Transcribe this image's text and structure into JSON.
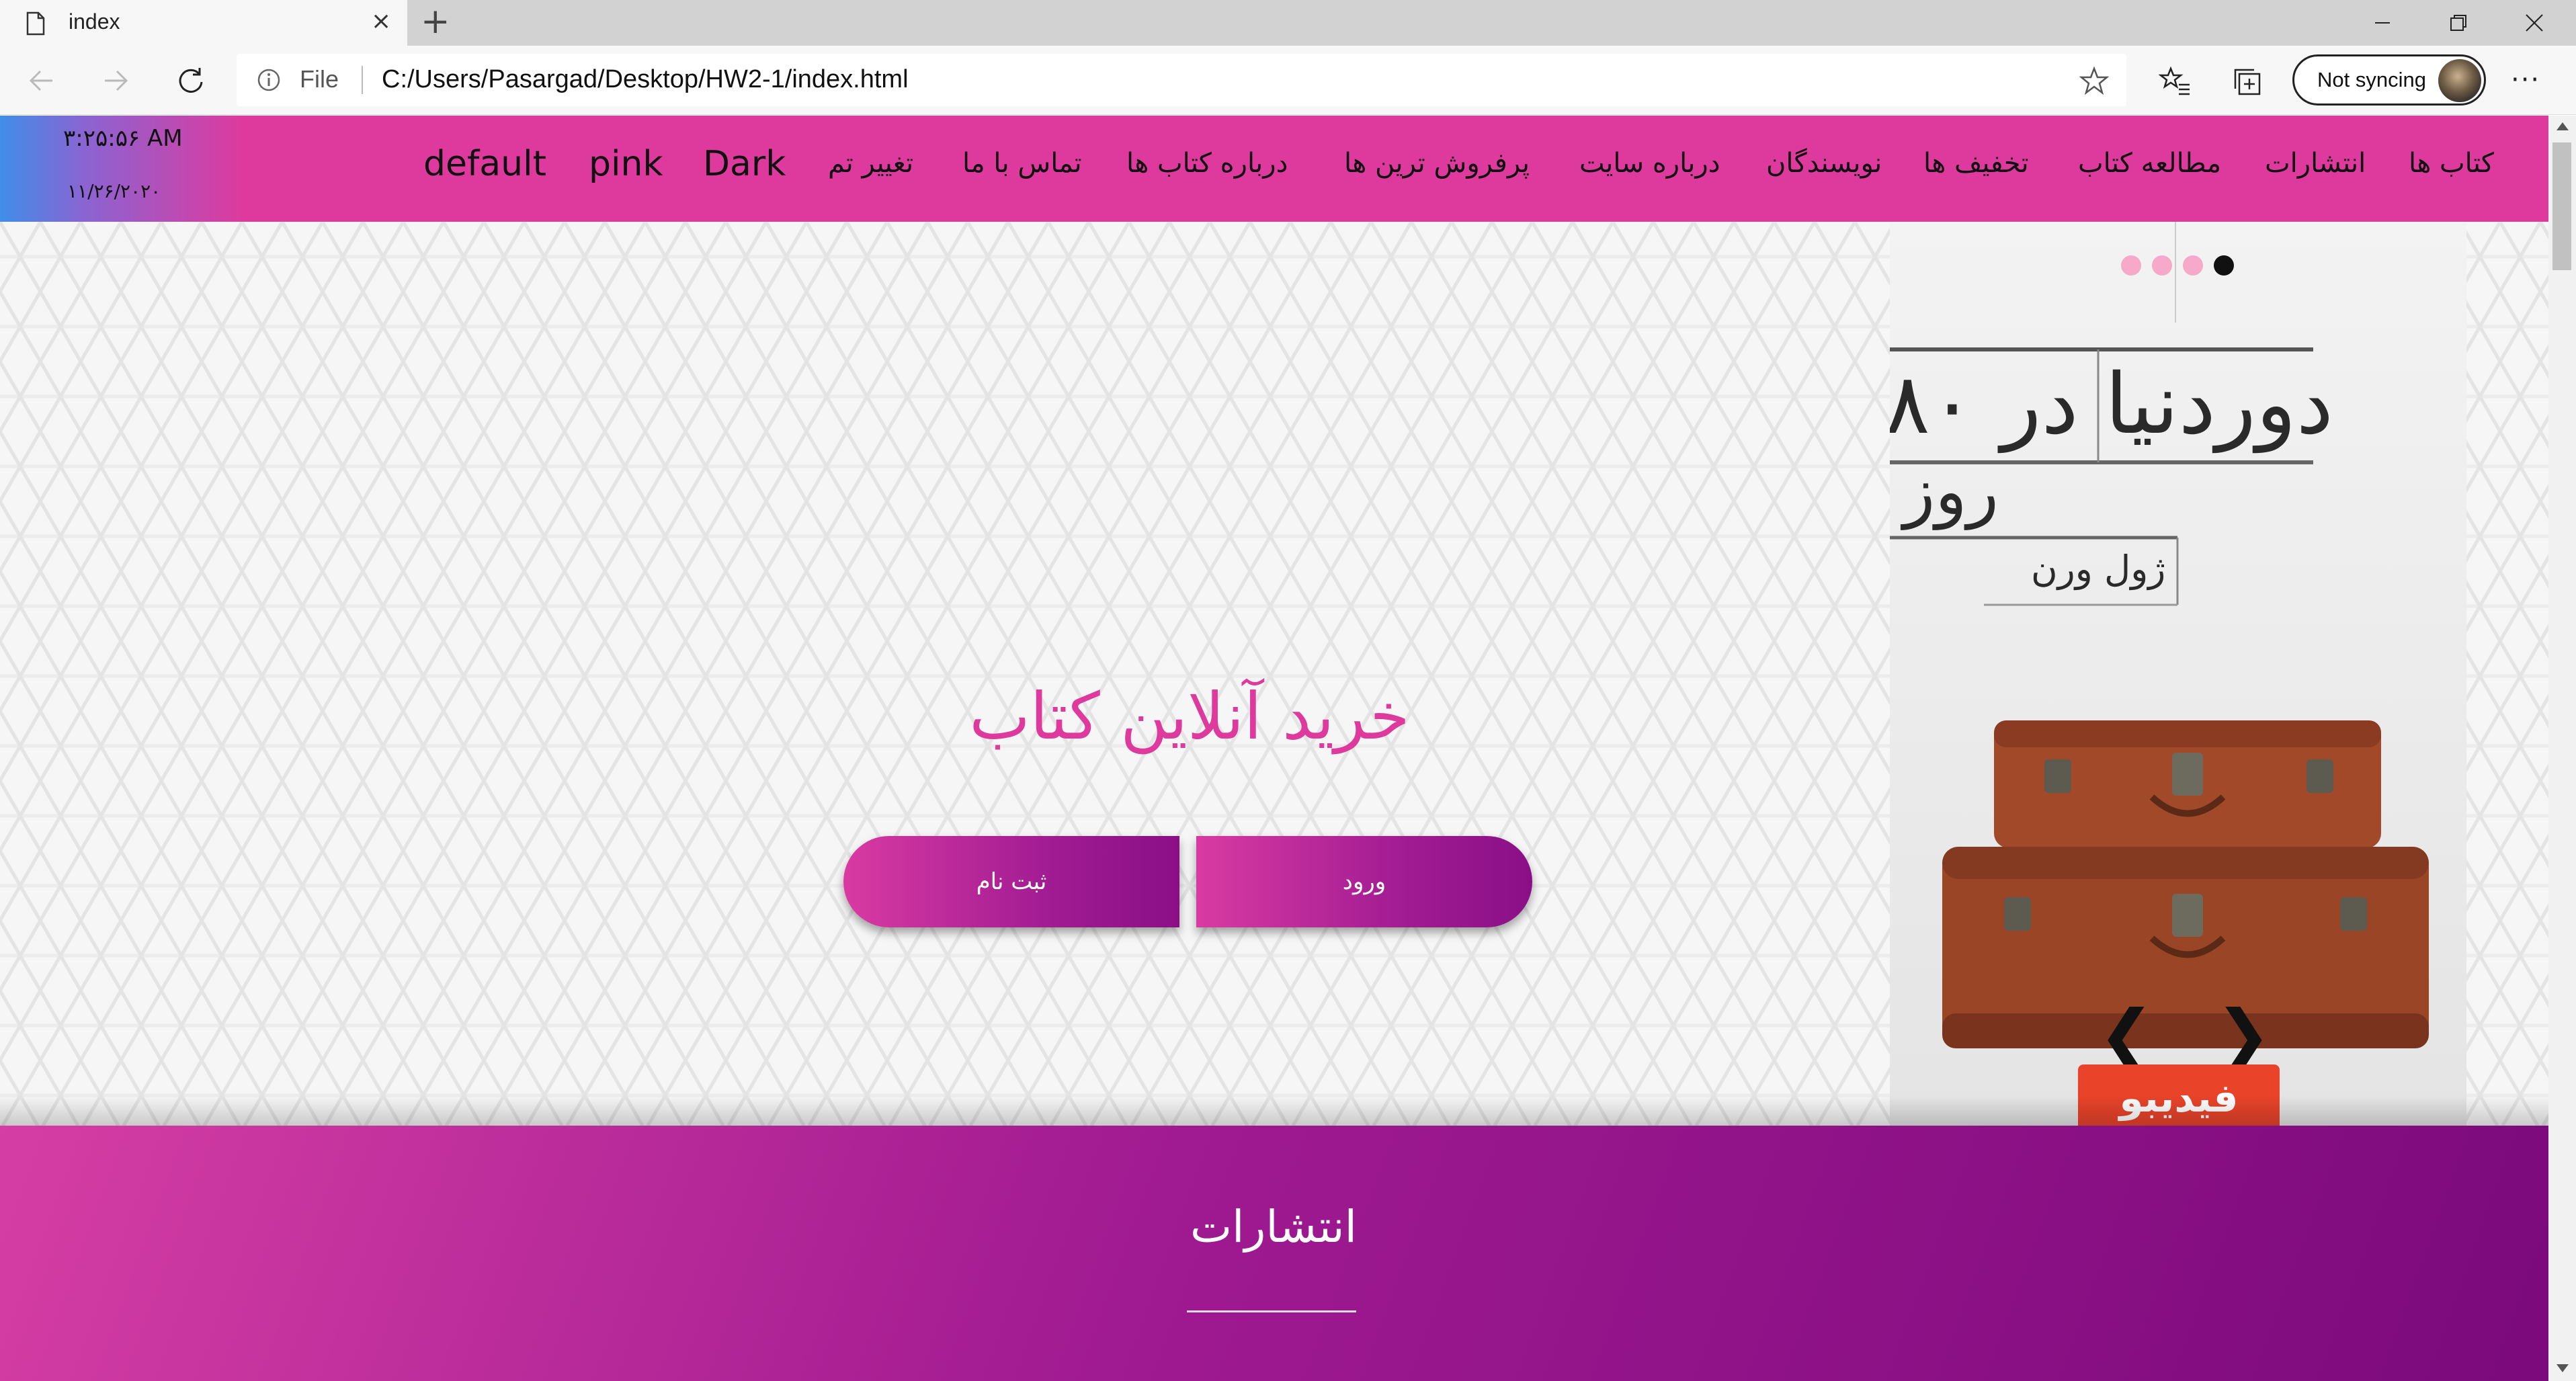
{
  "browser": {
    "tab_title": "index",
    "tab_close": "×",
    "new_tab": "+",
    "file_label": "File",
    "url": "C:/Users/Pasargad/Desktop/HW2-1/index.html",
    "sync_label": "Not syncing",
    "more": "···"
  },
  "site": {
    "clock_time": "۳:۲۵:۵۶ AM",
    "clock_date": "۱۱/۲۶/۲۰۲۰",
    "nav": [
      "کتاب ها",
      "انتشارات",
      "مطالعه کتاب",
      "تخفیف ها",
      "نویسندگان",
      "درباره سایت",
      "پرفروش ترین ها",
      "درباره کتاب ها",
      "تماس با ما",
      "تغییر تم"
    ],
    "themes": [
      "Dark",
      "pink",
      "default"
    ],
    "colors": {
      "accent": "#de3a9e",
      "deep": "#7b0a7c"
    }
  },
  "hero": {
    "title": "خرید آنلاین کتاب",
    "register_button": "ثبت نام",
    "login_button": "ورود"
  },
  "slider": {
    "cover_title": "دوردنیا در ۸۰",
    "cover_subtitle": "روز",
    "cover_author": "ژول ورن",
    "prev": "❮",
    "next": "❯",
    "video_badge": "فیدیبو"
  },
  "publications": {
    "title": "انتشارات"
  }
}
